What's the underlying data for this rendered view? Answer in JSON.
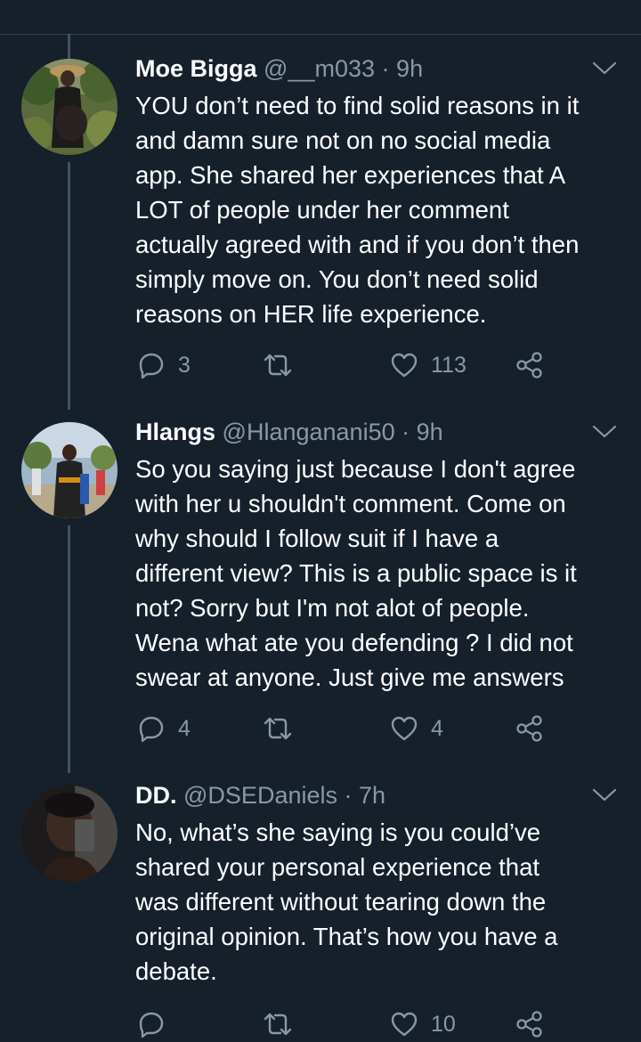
{
  "tweets": [
    {
      "name": "Moe Bigga",
      "handle": "@__m033",
      "separator": "·",
      "time": "9h",
      "text": "YOU don’t need to find solid reasons in it\nand damn sure not on no social media\napp. She shared her experiences that A\nLOT of people under her comment\nactually agreed with and if you don’t then\nsimply move on. You don’t need solid\nreasons on HER life experience.",
      "replies": "3",
      "retweets": "",
      "likes": "113",
      "avatar_icon": "user-avatar"
    },
    {
      "name": "Hlangs",
      "handle": "@Hlanganani50",
      "separator": "·",
      "time": "9h",
      "text": "So you saying just because I don't agree\nwith her u shouldn't comment. Come on\nwhy should I follow suit if I have a\ndifferent view? This is a public space is it\nnot? Sorry but I'm not alot of people.\nWena what ate you defending ? I did not\nswear at anyone. Just give me answers",
      "replies": "4",
      "retweets": "",
      "likes": "4",
      "avatar_icon": "user-avatar"
    },
    {
      "name": "DD.",
      "handle": "@DSEDaniels",
      "separator": "·",
      "time": "7h",
      "text": "No, what’s she saying is you could’ve\nshared your personal experience that\nwas different without tearing down the\noriginal opinion. That’s how you have a\ndebate.",
      "replies": "",
      "retweets": "",
      "likes": "10",
      "avatar_icon": "user-avatar"
    }
  ],
  "icons": {
    "reply": "reply-icon",
    "retweet": "retweet-icon",
    "like": "heart-icon",
    "share": "share-icon",
    "menu": "chevron-down-icon"
  },
  "colors": {
    "background": "#15202b",
    "secondary_text": "#8899a6",
    "thread_line": "#3d5466"
  }
}
